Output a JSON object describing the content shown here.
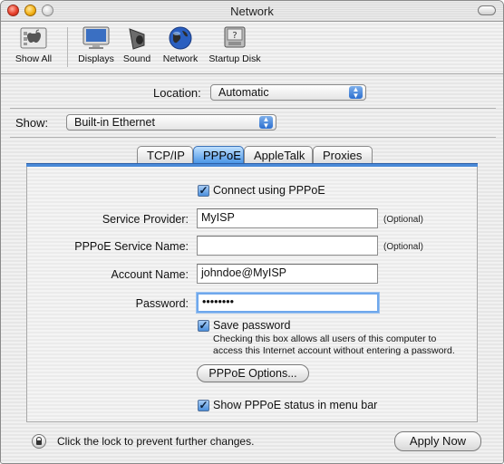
{
  "window": {
    "title": "Network"
  },
  "toolbar": {
    "items": [
      {
        "label": "Show All",
        "icon": "apple-grid-icon"
      },
      {
        "label": "Displays",
        "icon": "monitor-icon"
      },
      {
        "label": "Sound",
        "icon": "speaker-icon"
      },
      {
        "label": "Network",
        "icon": "globe-icon"
      },
      {
        "label": "Startup Disk",
        "icon": "disk-icon"
      }
    ]
  },
  "location": {
    "label": "Location:",
    "value": "Automatic"
  },
  "show": {
    "label": "Show:",
    "value": "Built-in Ethernet"
  },
  "tabs": [
    {
      "label": "TCP/IP",
      "active": false
    },
    {
      "label": "PPPoE",
      "active": true
    },
    {
      "label": "AppleTalk",
      "active": false
    },
    {
      "label": "Proxies",
      "active": false
    }
  ],
  "pppoe": {
    "connect_checkbox": {
      "label": "Connect using PPPoE",
      "checked": true
    },
    "service_provider": {
      "label": "Service Provider:",
      "value": "MyISP",
      "hint": "(Optional)"
    },
    "service_name": {
      "label": "PPPoE Service Name:",
      "value": "",
      "hint": "(Optional)"
    },
    "account_name": {
      "label": "Account Name:",
      "value": "johndoe@MyISP"
    },
    "password": {
      "label": "Password:",
      "value": "••••••••"
    },
    "save_password": {
      "label": "Save password",
      "checked": true
    },
    "note_line1": "Checking this box allows all users of this computer to",
    "note_line2": "access this Internet account without entering a password.",
    "options_button": "PPPoE Options...",
    "status_checkbox": {
      "label": "Show PPPoE status in menu bar",
      "checked": true
    }
  },
  "footer": {
    "lock_text": "Click the lock to prevent further changes.",
    "apply_button": "Apply Now"
  }
}
